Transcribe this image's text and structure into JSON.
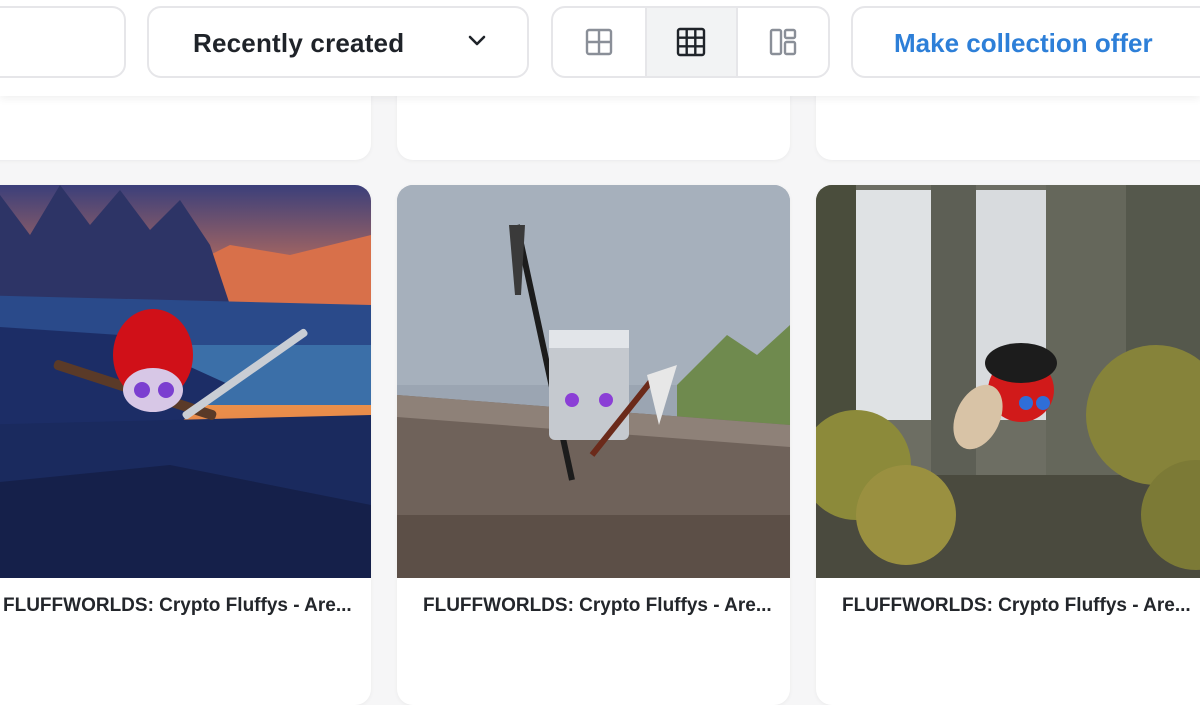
{
  "toolbar": {
    "sort_label": "Recently created",
    "view_modes": [
      "grid-large-icon",
      "grid-small-icon",
      "masonry-icon"
    ],
    "active_view": "grid-small-icon",
    "offer_label": "Make collection offer",
    "accent_color": "#2d7fd8"
  },
  "items": [
    {
      "title": "FLUFFWORLDS: Crypto Fluffys - Are..."
    },
    {
      "title": "FLUFFWORLDS: Crypto Fluffys - Are..."
    },
    {
      "title": "FLUFFWORLDS: Crypto Fluffys - Are..."
    }
  ]
}
